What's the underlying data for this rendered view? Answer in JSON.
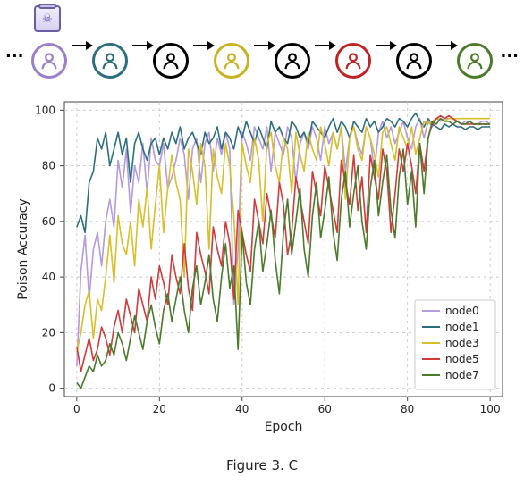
{
  "diagram": {
    "ellipsis_left": "...",
    "ellipsis_right": "...",
    "poison_label": "poison-icon",
    "nodes": [
      {
        "id": "node0",
        "color": "#9a7fcb",
        "poisoned": true
      },
      {
        "id": "node1",
        "color": "#2d6e7e",
        "poisoned": false
      },
      {
        "id": "node2",
        "color": "#000000",
        "poisoned": false
      },
      {
        "id": "node3",
        "color": "#c9b21f",
        "poisoned": false
      },
      {
        "id": "node4",
        "color": "#000000",
        "poisoned": false
      },
      {
        "id": "node5",
        "color": "#c02323",
        "poisoned": false
      },
      {
        "id": "node6",
        "color": "#000000",
        "poisoned": false
      },
      {
        "id": "node7",
        "color": "#4a7a2a",
        "poisoned": false
      }
    ]
  },
  "chart": {
    "xlabel": "Epoch",
    "ylabel": "Poison Accuracy",
    "xlim": [
      -3,
      103
    ],
    "ylim": [
      -3,
      103
    ],
    "xticks": [
      0,
      20,
      40,
      60,
      80,
      100
    ],
    "yticks": [
      0,
      20,
      40,
      60,
      80,
      100
    ],
    "legend_title": "",
    "grid": true
  },
  "caption": "Figure 3. C",
  "chart_data": {
    "type": "line",
    "title": "",
    "xlabel": "Epoch",
    "ylabel": "Poison Accuracy",
    "xlim": [
      -3,
      103
    ],
    "ylim": [
      -3,
      103
    ],
    "x": [
      0,
      1,
      2,
      3,
      4,
      5,
      6,
      7,
      8,
      9,
      10,
      11,
      12,
      13,
      14,
      15,
      16,
      17,
      18,
      19,
      20,
      21,
      22,
      23,
      24,
      25,
      26,
      27,
      28,
      29,
      30,
      31,
      32,
      33,
      34,
      35,
      36,
      37,
      38,
      39,
      40,
      41,
      42,
      43,
      44,
      45,
      46,
      47,
      48,
      49,
      50,
      51,
      52,
      53,
      54,
      55,
      56,
      57,
      58,
      59,
      60,
      61,
      62,
      63,
      64,
      65,
      66,
      67,
      68,
      69,
      70,
      71,
      72,
      73,
      74,
      75,
      76,
      77,
      78,
      79,
      80,
      81,
      82,
      83,
      84,
      85,
      86,
      87,
      88,
      89,
      90,
      91,
      92,
      93,
      94,
      95,
      96,
      97,
      98,
      99,
      100
    ],
    "series": [
      {
        "name": "node0",
        "color": "#b49adf",
        "values": [
          8,
          42,
          55,
          32,
          50,
          56,
          44,
          60,
          68,
          58,
          82,
          72,
          86,
          63,
          80,
          74,
          88,
          70,
          90,
          82,
          80,
          88,
          72,
          76,
          82,
          90,
          84,
          68,
          86,
          90,
          74,
          88,
          92,
          78,
          90,
          84,
          92,
          86,
          30,
          50,
          92,
          88,
          82,
          94,
          90,
          86,
          94,
          78,
          92,
          88,
          84,
          94,
          90,
          74,
          88,
          92,
          86,
          94,
          90,
          82,
          94,
          88,
          92,
          86,
          94,
          78,
          90,
          94,
          88,
          84,
          94,
          90,
          78,
          92,
          96,
          90,
          94,
          88,
          92,
          96,
          90,
          86,
          94,
          97,
          90,
          96,
          94,
          97,
          96,
          97,
          97,
          97,
          96,
          95,
          96,
          96,
          95,
          95,
          96,
          96,
          95
        ]
      },
      {
        "name": "node1",
        "color": "#2d6e7e",
        "values": [
          58,
          62,
          56,
          74,
          78,
          90,
          86,
          92,
          80,
          86,
          92,
          84,
          90,
          74,
          88,
          92,
          86,
          82,
          88,
          90,
          84,
          90,
          86,
          92,
          88,
          94,
          86,
          90,
          92,
          88,
          84,
          92,
          88,
          90,
          94,
          86,
          92,
          90,
          86,
          94,
          90,
          96,
          92,
          88,
          94,
          90,
          86,
          96,
          92,
          94,
          90,
          88,
          96,
          94,
          90,
          92,
          88,
          96,
          94,
          92,
          90,
          94,
          97,
          92,
          96,
          94,
          90,
          96,
          94,
          92,
          97,
          94,
          96,
          92,
          94,
          97,
          96,
          94,
          97,
          96,
          94,
          97,
          99,
          96,
          94,
          97,
          95,
          94,
          93,
          95,
          94,
          95,
          94,
          94,
          93,
          94,
          94,
          93,
          94,
          94,
          94
        ]
      },
      {
        "name": "node3",
        "color": "#d8bf2a",
        "values": [
          13,
          20,
          30,
          35,
          18,
          32,
          28,
          40,
          55,
          38,
          62,
          52,
          48,
          60,
          44,
          68,
          58,
          72,
          50,
          66,
          80,
          56,
          72,
          84,
          74,
          68,
          40,
          86,
          78,
          66,
          88,
          80,
          50,
          86,
          76,
          70,
          88,
          80,
          62,
          30,
          88,
          80,
          74,
          90,
          82,
          60,
          88,
          92,
          80,
          74,
          90,
          86,
          70,
          92,
          84,
          78,
          92,
          86,
          82,
          94,
          88,
          80,
          92,
          86,
          94,
          68,
          90,
          94,
          86,
          82,
          94,
          90,
          84,
          76,
          92,
          94,
          88,
          82,
          94,
          90,
          86,
          94,
          84,
          90,
          96,
          95,
          96,
          97,
          97,
          96,
          97,
          97,
          97,
          97,
          97,
          97,
          97,
          97,
          97,
          97,
          97
        ]
      },
      {
        "name": "node5",
        "color": "#d23b3b",
        "values": [
          15,
          6,
          12,
          18,
          10,
          14,
          22,
          18,
          12,
          22,
          28,
          20,
          32,
          26,
          20,
          36,
          30,
          24,
          40,
          32,
          44,
          38,
          30,
          48,
          40,
          34,
          52,
          36,
          28,
          56,
          48,
          42,
          34,
          58,
          50,
          44,
          60,
          52,
          32,
          64,
          56,
          48,
          42,
          68,
          60,
          52,
          70,
          62,
          54,
          74,
          66,
          48,
          56,
          76,
          68,
          60,
          52,
          78,
          70,
          62,
          80,
          72,
          64,
          56,
          82,
          74,
          66,
          84,
          64,
          76,
          56,
          84,
          76,
          68,
          86,
          78,
          56,
          70,
          86,
          78,
          88,
          80,
          70,
          88,
          78,
          90,
          95,
          97,
          98,
          97,
          98,
          97,
          96,
          95,
          95,
          95,
          95,
          95,
          95,
          95,
          95
        ]
      },
      {
        "name": "node7",
        "color": "#4a7a2a",
        "values": [
          2,
          0,
          4,
          8,
          6,
          12,
          8,
          10,
          16,
          12,
          20,
          16,
          10,
          18,
          26,
          20,
          14,
          24,
          30,
          22,
          16,
          28,
          34,
          24,
          32,
          40,
          28,
          20,
          36,
          44,
          30,
          38,
          48,
          32,
          24,
          40,
          52,
          36,
          44,
          14,
          56,
          38,
          30,
          50,
          60,
          42,
          52,
          64,
          46,
          34,
          56,
          68,
          48,
          60,
          72,
          50,
          40,
          62,
          74,
          54,
          64,
          76,
          56,
          46,
          68,
          78,
          58,
          70,
          80,
          60,
          50,
          72,
          82,
          62,
          74,
          84,
          64,
          54,
          76,
          86,
          66,
          78,
          58,
          88,
          70,
          90,
          96,
          95,
          97,
          96,
          96,
          95,
          96,
          95,
          95,
          96,
          95,
          95,
          95,
          95,
          95
        ]
      }
    ],
    "legend": [
      "node0",
      "node1",
      "node3",
      "node5",
      "node7"
    ]
  }
}
